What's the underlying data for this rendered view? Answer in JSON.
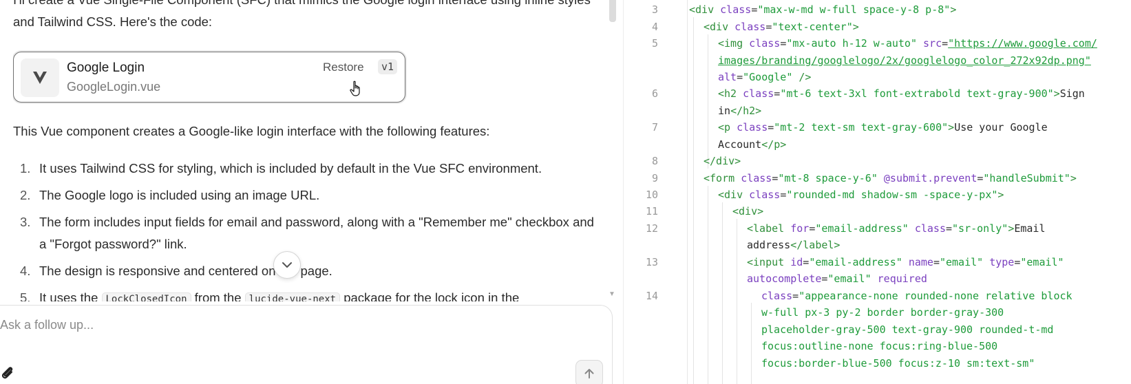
{
  "chat": {
    "intro": "I'll create a Vue Single-File Component (SFC) that mimics the Google login interface using inline styles and Tailwind CSS. Here's the code:",
    "artifact": {
      "title": "Google Login",
      "filename": "GoogleLogin.vue",
      "restore_label": "Restore",
      "version": "v1",
      "icon": "vue-logo-icon"
    },
    "features_intro": "This Vue component creates a Google-like login interface with the following features:",
    "features": [
      {
        "num": "1.",
        "text": "It uses Tailwind CSS for styling, which is included by default in the Vue SFC environment."
      },
      {
        "num": "2.",
        "text": "The Google logo is included using an image URL."
      },
      {
        "num": "3.",
        "text": "The form includes input fields for email and password, along with a \"Remember me\" checkbox and a \"Forgot password?\" link."
      },
      {
        "num": "4.",
        "text": "The design is responsive and centered on the page."
      },
      {
        "num": "5.",
        "pre": "It uses the ",
        "code1": "LockClosedIcon",
        "mid": " from the ",
        "code2": "lucide-vue-next",
        "post": " package for the lock icon in the"
      }
    ],
    "followup_placeholder": "Ask a follow up...",
    "icons": {
      "scroll": "chevron-down-icon",
      "attach": "paperclip-icon",
      "send": "arrow-up-icon",
      "cursor": "hand-pointer-icon"
    }
  },
  "code": {
    "line_numbers": [
      "3",
      "4",
      "5",
      "6",
      "7",
      "8",
      "9",
      "10",
      "11",
      "12",
      "13",
      "14"
    ]
  }
}
